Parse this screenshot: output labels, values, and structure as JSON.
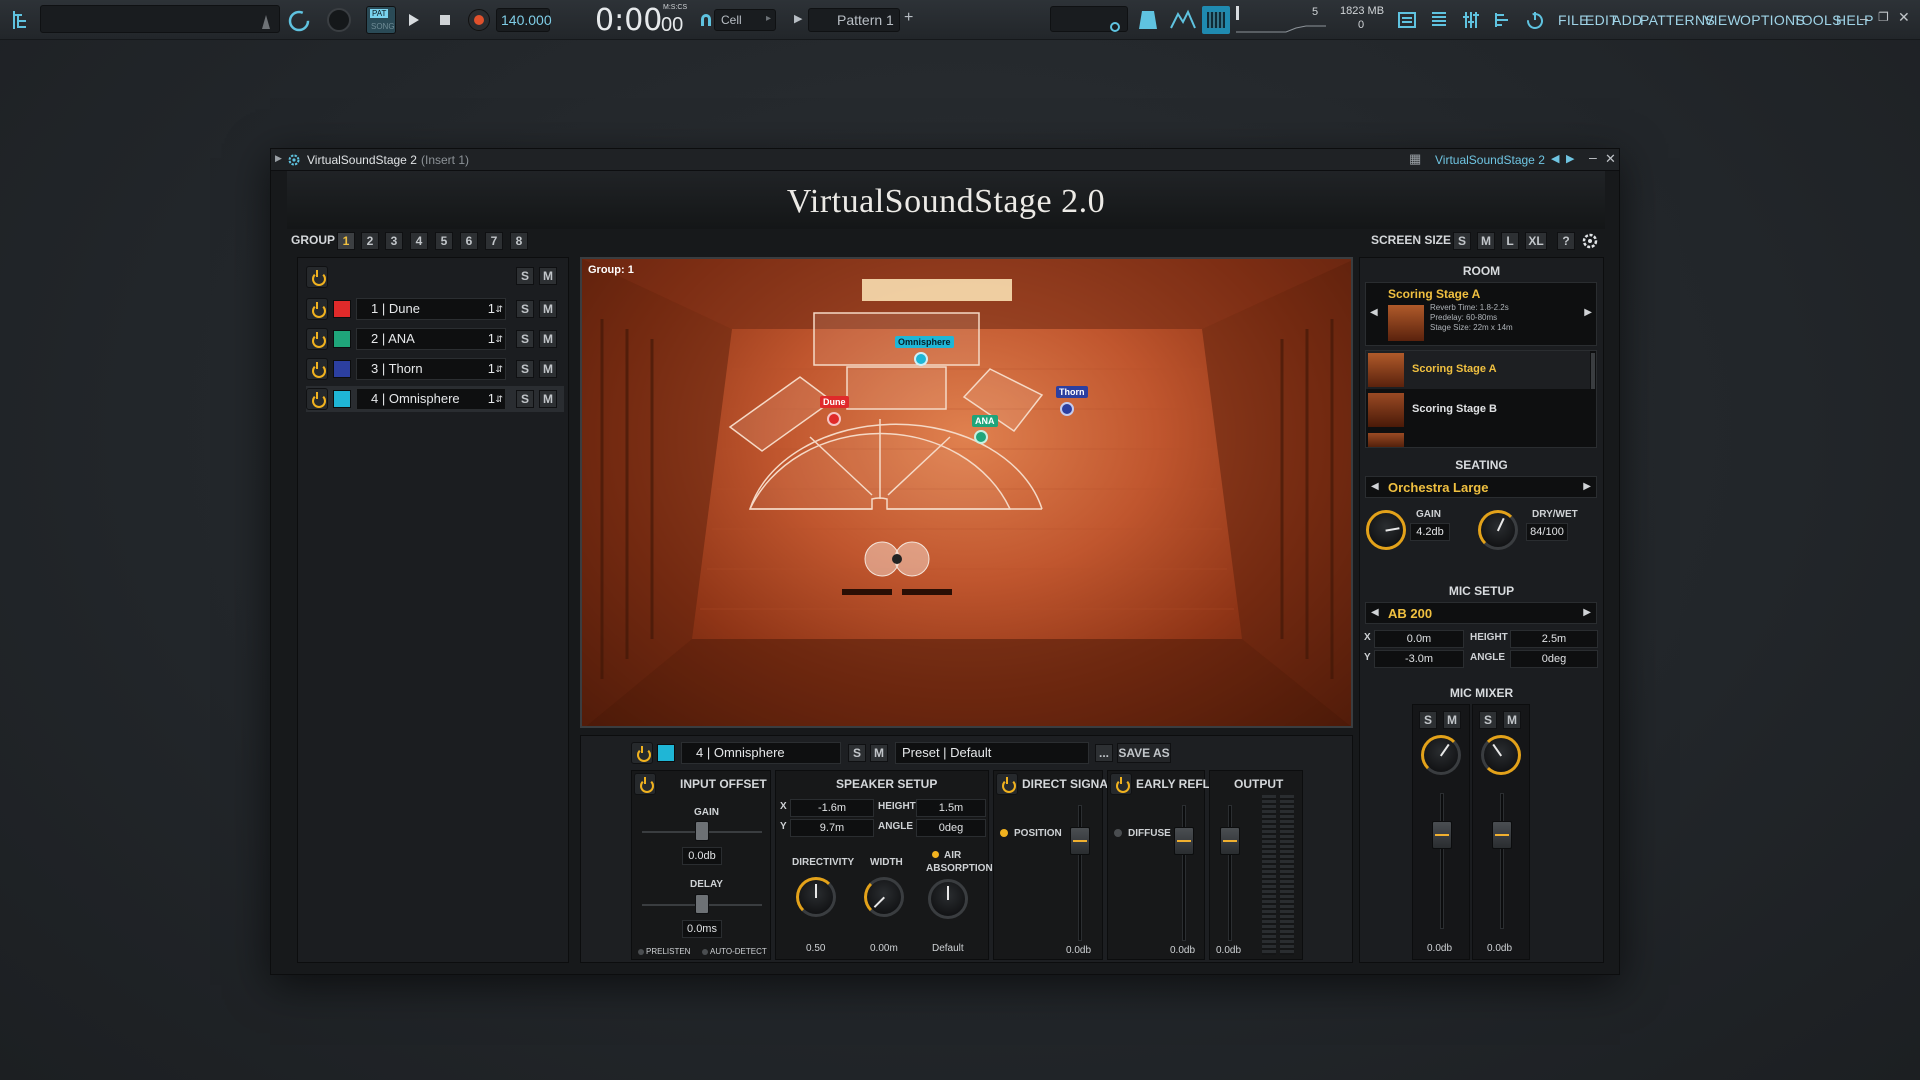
{
  "daw": {
    "tempo": "140.000",
    "time": "0:00",
    "time_small": "00",
    "time_unit": "M:S:CS",
    "pat_label": "PAT",
    "song_label": "SONG",
    "snap": "Cell",
    "pattern": "Pattern 1",
    "cpu_count": "5",
    "memory": "1823 MB",
    "voices": "0",
    "menu": [
      "FILE",
      "EDIT",
      "ADD",
      "PATTERNS",
      "VIEW",
      "OPTIONS",
      "TOOLS",
      "HELP"
    ]
  },
  "plugin": {
    "window_title": "VirtualSoundStage 2",
    "window_insert": "(Insert 1)",
    "window_tab": "VirtualSoundStage 2",
    "logo": "VirtualSoundStage 2.0",
    "group_label": "GROUP",
    "groups": [
      "1",
      "2",
      "3",
      "4",
      "5",
      "6",
      "7",
      "8"
    ],
    "active_group": "1",
    "screen_size_label": "SCREEN SIZE",
    "screen_sizes": [
      "S",
      "M",
      "L",
      "XL"
    ],
    "help": "?",
    "solo": "S",
    "mute": "M"
  },
  "tracks": [
    {
      "num": "1",
      "name": "Dune",
      "count": "1",
      "color": "#e02a2a"
    },
    {
      "num": "2",
      "name": "ANA",
      "count": "1",
      "color": "#1fa57a"
    },
    {
      "num": "3",
      "name": "Thorn",
      "count": "1",
      "color": "#2c3fa0"
    },
    {
      "num": "4",
      "name": "Omnisphere",
      "count": "1",
      "color": "#1fb6d6"
    }
  ],
  "stage": {
    "group_label": "Group: 1",
    "instruments": [
      "Omnisphere",
      "Dune",
      "ANA",
      "Thorn"
    ]
  },
  "room": {
    "title": "ROOM",
    "current": "Scoring Stage A",
    "reverb": "Reverb Time: 1.8-2.2s",
    "predelay": "Predelay: 60-80ms",
    "stage_size": "Stage Size: 22m x 14m",
    "list": [
      "Scoring Stage A",
      "Scoring Stage B"
    ]
  },
  "seating": {
    "title": "SEATING",
    "preset": "Orchestra Large",
    "gain_label": "GAIN",
    "gain_value": "4.2db",
    "drywet_label": "DRY/WET",
    "drywet_value": "84/100"
  },
  "mic_setup": {
    "title": "MIC SETUP",
    "preset": "AB 200",
    "x_label": "X",
    "x_value": "0.0m",
    "y_label": "Y",
    "y_value": "-3.0m",
    "height_label": "HEIGHT",
    "height_value": "2.5m",
    "angle_label": "ANGLE",
    "angle_value": "0deg"
  },
  "mic_mixer": {
    "title": "MIC MIXER",
    "ch1_value": "0.0db",
    "ch2_value": "0.0db"
  },
  "detail": {
    "track_name": "4 | Omnisphere",
    "preset": "Preset | Default",
    "dots": "...",
    "save_as": "SAVE AS",
    "input_offset": {
      "title": "INPUT OFFSET",
      "gain_label": "GAIN",
      "gain_value": "0.0db",
      "delay_label": "DELAY",
      "delay_value": "0.0ms",
      "prelisten": "PRELISTEN",
      "auto_detect": "AUTO-DETECT"
    },
    "speaker_setup": {
      "title": "SPEAKER SETUP",
      "x_label": "X",
      "x_value": "-1.6m",
      "y_label": "Y",
      "y_value": "9.7m",
      "height_label": "HEIGHT",
      "height_value": "1.5m",
      "angle_label": "ANGLE",
      "angle_value": "0deg",
      "directivity_label": "DIRECTIVITY",
      "directivity_value": "0.50",
      "width_label": "WIDTH",
      "width_value": "0.00m",
      "air_label_1": "AIR",
      "air_label_2": "ABSORPTION",
      "air_value": "Default"
    },
    "direct_signal": {
      "title": "DIRECT SIGNAL",
      "position": "POSITION",
      "value": "0.0db"
    },
    "early_refl": {
      "title": "EARLY REFL",
      "diffuse": "DIFFUSE",
      "value": "0.0db"
    },
    "output": {
      "title": "OUTPUT",
      "value": "0.0db"
    }
  }
}
